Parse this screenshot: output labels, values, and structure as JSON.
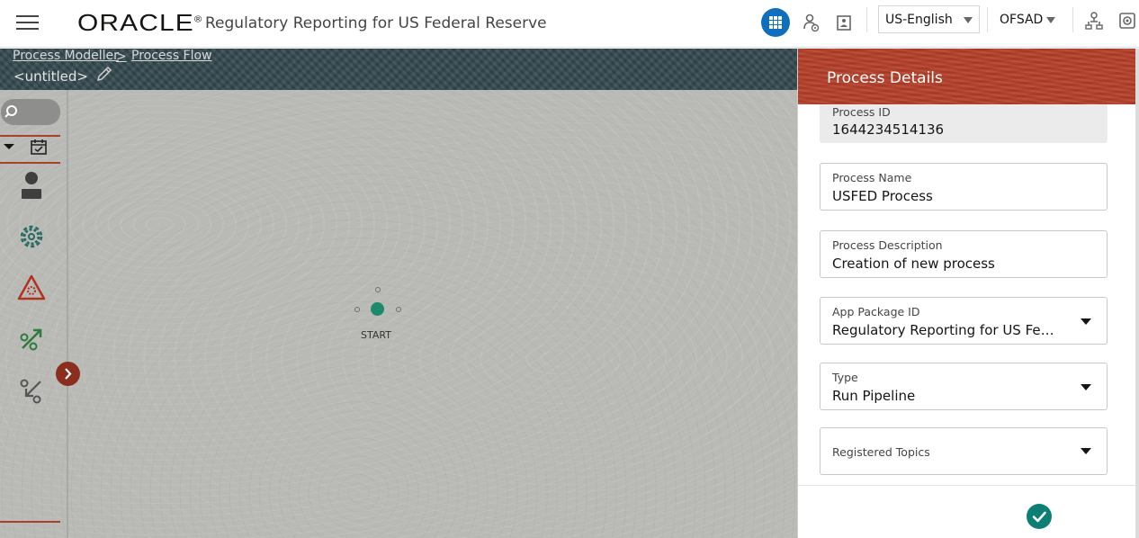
{
  "header": {
    "logo": "ORACLE",
    "logo_mark": "®",
    "app_title": "Regulatory Reporting for US Federal Reserve",
    "language": "US-English",
    "user": "OFSAD",
    "icons": [
      "menu-icon",
      "apps-grid-icon",
      "user-tasks-icon",
      "report-icon",
      "user-admin-icon",
      "settings-icon"
    ]
  },
  "breadcrumb": {
    "items": [
      "Process Modeller",
      "Process Flow"
    ],
    "separator": ">",
    "document_title": "<untitled>"
  },
  "palette": {
    "icons": [
      "search-icon",
      "collapse-caret-icon",
      "calendar-icon",
      "human-task-icon",
      "service-task-icon",
      "alert-task-icon",
      "subprocess-expand-icon",
      "subprocess-collapse-icon",
      "expand-chevron-icon"
    ]
  },
  "canvas": {
    "start_label": "START"
  },
  "panel": {
    "title": "Process Details",
    "fields": {
      "process_id": {
        "label": "Process ID",
        "value": "1644234514136"
      },
      "process_name": {
        "label": "Process Name",
        "value": "USFED Process"
      },
      "process_description": {
        "label": "Process Description",
        "value": "Creation of new process"
      },
      "app_package_id": {
        "label": "App Package ID",
        "value": "Regulatory Reporting for US Fede..."
      },
      "type": {
        "label": "Type",
        "value": "Run Pipeline"
      },
      "registered_topics": {
        "label": "Registered Topics",
        "value": ""
      }
    }
  },
  "colors": {
    "accent_blue": "#0f6fbe",
    "header_red": "#b7402a",
    "start_green": "#1e8a6b",
    "confirm_teal": "#0b7f74"
  }
}
